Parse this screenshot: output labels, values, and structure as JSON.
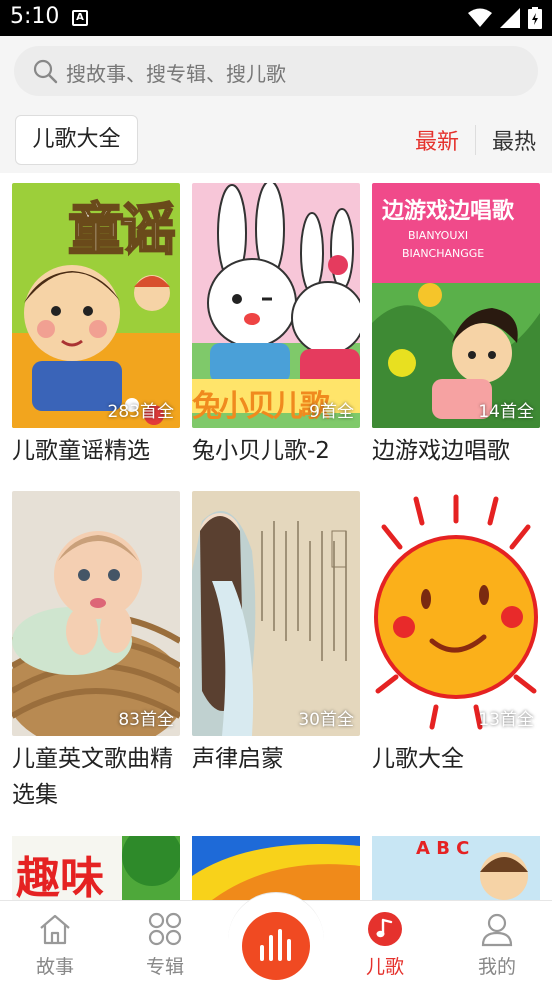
{
  "status_bar": {
    "time": "5:10",
    "notification_icon": "A"
  },
  "search": {
    "placeholder": "搜故事、搜专辑、搜儿歌"
  },
  "category_tag": "儿歌大全",
  "sort": {
    "newest": "最新",
    "hottest": "最热",
    "active": "newest"
  },
  "albums": [
    {
      "title": "儿歌童谣精选",
      "count": "283首全",
      "cover_text": "童谣"
    },
    {
      "title": "兔小贝儿歌-2",
      "count": "9首全",
      "cover_text": "兔小贝儿歌"
    },
    {
      "title": "边游戏边唱歌",
      "count": "14首全",
      "cover_text": "边游戏边唱歌",
      "cover_sub1": "BIANYOUXI",
      "cover_sub2": "BIANCHANGGE"
    },
    {
      "title": "儿童英文歌曲精选集",
      "count": "83首全"
    },
    {
      "title": "声律启蒙",
      "count": "30首全"
    },
    {
      "title": "儿歌大全",
      "count": "13首全"
    }
  ],
  "partial_covers": [
    {
      "cover_text": "趣味"
    },
    {},
    {
      "cover_text": "A B C"
    }
  ],
  "tabs": [
    {
      "label": "故事",
      "icon": "house-icon"
    },
    {
      "label": "专辑",
      "icon": "grid-icon"
    },
    {
      "label": "儿歌",
      "icon": "music-note-icon",
      "active": true
    },
    {
      "label": "我的",
      "icon": "person-icon"
    }
  ],
  "colors": {
    "accent": "#e5322d",
    "play_button": "#f04a22"
  }
}
